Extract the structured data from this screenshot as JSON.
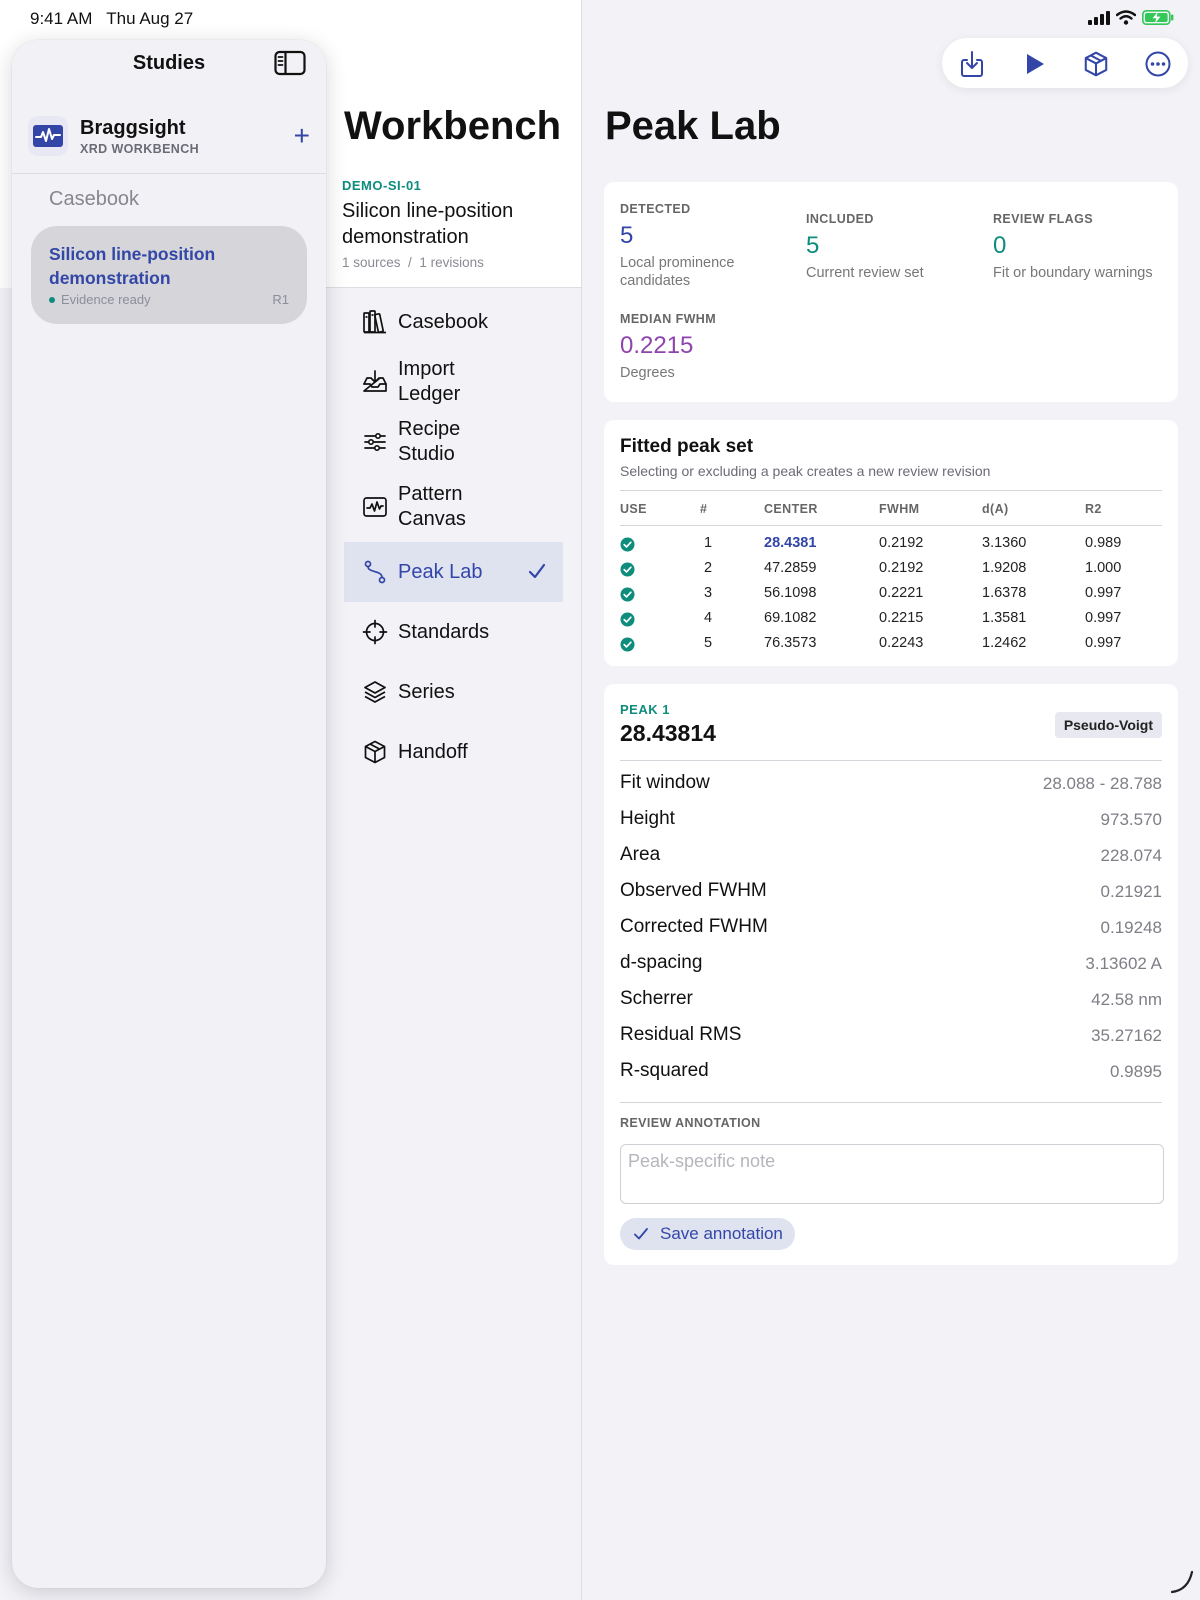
{
  "status_bar": {
    "time": "9:41 AM",
    "date": "Thu Aug 27"
  },
  "sidebar": {
    "title": "Studies",
    "app": {
      "name": "Braggsight",
      "subtitle": "XRD WORKBENCH",
      "add_label": "+"
    },
    "section": "Casebook",
    "study": {
      "title": "Silicon line-position demonstration",
      "status": "Evidence ready",
      "revision": "R1"
    }
  },
  "workbench": {
    "title": "Workbench",
    "study_code": "DEMO-SI-01",
    "study_name": "Silicon line-position demonstration",
    "meta_sources": "1 sources",
    "meta_sep": "/",
    "meta_revisions": "1 revisions",
    "nav": [
      {
        "label": "Casebook",
        "icon": "books-icon"
      },
      {
        "label": "Import Ledger",
        "icon": "tray-icon"
      },
      {
        "label": "Recipe Studio",
        "icon": "sliders-icon"
      },
      {
        "label": "Pattern Canvas",
        "icon": "waveform-icon"
      },
      {
        "label": "Peak Lab",
        "icon": "path-icon",
        "active": true
      },
      {
        "label": "Standards",
        "icon": "crosshair-icon"
      },
      {
        "label": "Series",
        "icon": "layers-icon"
      },
      {
        "label": "Handoff",
        "icon": "cube-icon"
      }
    ]
  },
  "toolbar": {
    "buttons": [
      "import-icon",
      "play-icon",
      "cube-icon",
      "more-icon"
    ]
  },
  "peak_lab": {
    "title": "Peak Lab",
    "stats": {
      "detected": {
        "label": "DETECTED",
        "value": "5",
        "desc": "Local prominence candidates"
      },
      "included": {
        "label": "INCLUDED",
        "value": "5",
        "desc": "Current review set"
      },
      "flags": {
        "label": "REVIEW FLAGS",
        "value": "0",
        "desc": "Fit or boundary warnings"
      },
      "median": {
        "label": "MEDIAN FWHM",
        "value": "0.2215",
        "desc": "Degrees"
      }
    },
    "colors": {
      "accent": "#3346a8",
      "teal": "#0e8c7c",
      "purple": "#8e44ad"
    },
    "table": {
      "title": "Fitted peak set",
      "subtitle": "Selecting or excluding a peak creates a new review revision",
      "headers": [
        "USE",
        "#",
        "CENTER",
        "FWHM",
        "d(A)",
        "R2"
      ],
      "rows": [
        {
          "n": "1",
          "center": "28.4381",
          "fwhm": "0.2192",
          "d": "3.1360",
          "r2": "0.989"
        },
        {
          "n": "2",
          "center": "47.2859",
          "fwhm": "0.2192",
          "d": "1.9208",
          "r2": "1.000"
        },
        {
          "n": "3",
          "center": "56.1098",
          "fwhm": "0.2221",
          "d": "1.6378",
          "r2": "0.997"
        },
        {
          "n": "4",
          "center": "69.1082",
          "fwhm": "0.2215",
          "d": "1.3581",
          "r2": "0.997"
        },
        {
          "n": "5",
          "center": "76.3573",
          "fwhm": "0.2243",
          "d": "1.2462",
          "r2": "0.997"
        }
      ]
    },
    "detail": {
      "kicker": "PEAK 1",
      "value": "28.43814",
      "badge": "Pseudo-Voigt",
      "rows": [
        {
          "label": "Fit window",
          "value": "28.088 - 28.788"
        },
        {
          "label": "Height",
          "value": "973.570"
        },
        {
          "label": "Area",
          "value": "228.074"
        },
        {
          "label": "Observed FWHM",
          "value": "0.21921"
        },
        {
          "label": "Corrected FWHM",
          "value": "0.19248"
        },
        {
          "label": "d-spacing",
          "value": "3.13602 A"
        },
        {
          "label": "Scherrer",
          "value": "42.58 nm"
        },
        {
          "label": "Residual RMS",
          "value": "35.27162"
        },
        {
          "label": "R-squared",
          "value": "0.9895"
        }
      ],
      "review_label": "REVIEW ANNOTATION",
      "note_placeholder": "Peak-specific note",
      "note_value": "",
      "save_label": "Save annotation"
    }
  }
}
